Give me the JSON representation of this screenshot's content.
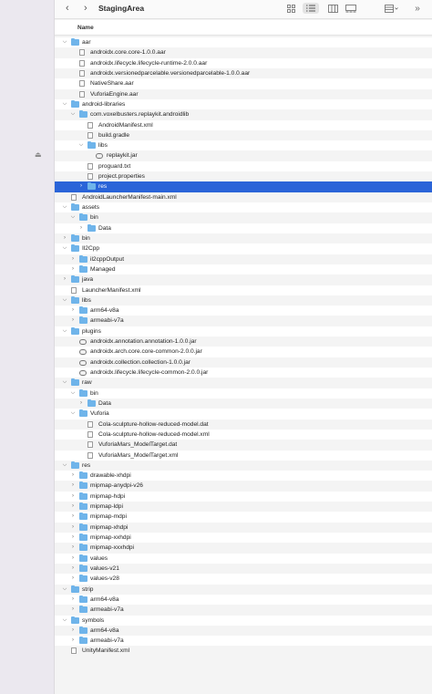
{
  "window": {
    "title": "StagingArea"
  },
  "toolbar": {
    "back_glyph": "‹",
    "forward_glyph": "›",
    "view_buttons": [
      "icon-view",
      "list-view",
      "column-view",
      "gallery-view",
      "group-view",
      "more"
    ]
  },
  "header": {
    "column_name": "Name"
  },
  "colors": {
    "selection": "#2a64d8",
    "folder": "#6fb4ea"
  },
  "tree": [
    {
      "label": "aar",
      "depth": 0,
      "type": "folder",
      "expanded": true
    },
    {
      "label": "androidx.core.core-1.0.0.aar",
      "depth": 1,
      "type": "doc"
    },
    {
      "label": "androidx.lifecycle.lifecycle-runtime-2.0.0.aar",
      "depth": 1,
      "type": "doc"
    },
    {
      "label": "androidx.versionedparcelable.versionedparcelable-1.0.0.aar",
      "depth": 1,
      "type": "doc"
    },
    {
      "label": "NativeShare.aar",
      "depth": 1,
      "type": "doc"
    },
    {
      "label": "VuforiaEngine.aar",
      "depth": 1,
      "type": "doc"
    },
    {
      "label": "android-libraries",
      "depth": 0,
      "type": "folder",
      "expanded": true
    },
    {
      "label": "com.voxelbusters.replaykit.androidlib",
      "depth": 1,
      "type": "folder",
      "expanded": true
    },
    {
      "label": "AndroidManifest.xml",
      "depth": 2,
      "type": "doc"
    },
    {
      "label": "build.gradle",
      "depth": 2,
      "type": "doc"
    },
    {
      "label": "libs",
      "depth": 2,
      "type": "folder",
      "expanded": true
    },
    {
      "label": "replaykit.jar",
      "depth": 3,
      "type": "jar"
    },
    {
      "label": "proguard.txt",
      "depth": 2,
      "type": "doc"
    },
    {
      "label": "project.properties",
      "depth": 2,
      "type": "doc"
    },
    {
      "label": "res",
      "depth": 2,
      "type": "folder",
      "expanded": false,
      "selected": true
    },
    {
      "label": "AndroidLauncherManifest-main.xml",
      "depth": 0,
      "type": "doc"
    },
    {
      "label": "assets",
      "depth": 0,
      "type": "folder",
      "expanded": true
    },
    {
      "label": "bin",
      "depth": 1,
      "type": "folder",
      "expanded": true
    },
    {
      "label": "Data",
      "depth": 2,
      "type": "folder",
      "expanded": false
    },
    {
      "label": "bin",
      "depth": 0,
      "type": "folder",
      "expanded": false
    },
    {
      "label": "Il2Cpp",
      "depth": 0,
      "type": "folder",
      "expanded": true
    },
    {
      "label": "il2cppOutput",
      "depth": 1,
      "type": "folder",
      "expanded": false
    },
    {
      "label": "Managed",
      "depth": 1,
      "type": "folder",
      "expanded": false
    },
    {
      "label": "java",
      "depth": 0,
      "type": "folder",
      "expanded": false
    },
    {
      "label": "LauncherManifest.xml",
      "depth": 0,
      "type": "doc"
    },
    {
      "label": "libs",
      "depth": 0,
      "type": "folder",
      "expanded": true
    },
    {
      "label": "arm64-v8a",
      "depth": 1,
      "type": "folder",
      "expanded": false
    },
    {
      "label": "armeabi-v7a",
      "depth": 1,
      "type": "folder",
      "expanded": false
    },
    {
      "label": "plugins",
      "depth": 0,
      "type": "folder",
      "expanded": true
    },
    {
      "label": "androidx.annotation.annotation-1.0.0.jar",
      "depth": 1,
      "type": "jar"
    },
    {
      "label": "androidx.arch.core.core-common-2.0.0.jar",
      "depth": 1,
      "type": "jar"
    },
    {
      "label": "androidx.collection.collection-1.0.0.jar",
      "depth": 1,
      "type": "jar"
    },
    {
      "label": "androidx.lifecycle.lifecycle-common-2.0.0.jar",
      "depth": 1,
      "type": "jar"
    },
    {
      "label": "raw",
      "depth": 0,
      "type": "folder",
      "expanded": true
    },
    {
      "label": "bin",
      "depth": 1,
      "type": "folder",
      "expanded": true
    },
    {
      "label": "Data",
      "depth": 2,
      "type": "folder",
      "expanded": false
    },
    {
      "label": "Vuforia",
      "depth": 1,
      "type": "folder",
      "expanded": true
    },
    {
      "label": "Cola-sculpture-hollow-reduced-model.dat",
      "depth": 2,
      "type": "doc"
    },
    {
      "label": "Cola-sculpture-hollow-reduced-model.xml",
      "depth": 2,
      "type": "doc"
    },
    {
      "label": "VuforiaMars_ModelTarget.dat",
      "depth": 2,
      "type": "doc"
    },
    {
      "label": "VuforiaMars_ModelTarget.xml",
      "depth": 2,
      "type": "doc"
    },
    {
      "label": "res",
      "depth": 0,
      "type": "folder",
      "expanded": true
    },
    {
      "label": "drawable-xhdpi",
      "depth": 1,
      "type": "folder",
      "expanded": false
    },
    {
      "label": "mipmap-anydpi-v26",
      "depth": 1,
      "type": "folder",
      "expanded": false
    },
    {
      "label": "mipmap-hdpi",
      "depth": 1,
      "type": "folder",
      "expanded": false
    },
    {
      "label": "mipmap-ldpi",
      "depth": 1,
      "type": "folder",
      "expanded": false
    },
    {
      "label": "mipmap-mdpi",
      "depth": 1,
      "type": "folder",
      "expanded": false
    },
    {
      "label": "mipmap-xhdpi",
      "depth": 1,
      "type": "folder",
      "expanded": false
    },
    {
      "label": "mipmap-xxhdpi",
      "depth": 1,
      "type": "folder",
      "expanded": false
    },
    {
      "label": "mipmap-xxxhdpi",
      "depth": 1,
      "type": "folder",
      "expanded": false
    },
    {
      "label": "values",
      "depth": 1,
      "type": "folder",
      "expanded": false
    },
    {
      "label": "values-v21",
      "depth": 1,
      "type": "folder",
      "expanded": false
    },
    {
      "label": "values-v28",
      "depth": 1,
      "type": "folder",
      "expanded": false
    },
    {
      "label": "strip",
      "depth": 0,
      "type": "folder",
      "expanded": true
    },
    {
      "label": "arm64-v8a",
      "depth": 1,
      "type": "folder",
      "expanded": false
    },
    {
      "label": "armeabi-v7a",
      "depth": 1,
      "type": "folder",
      "expanded": false
    },
    {
      "label": "symbols",
      "depth": 0,
      "type": "folder",
      "expanded": true
    },
    {
      "label": "arm64-v8a",
      "depth": 1,
      "type": "folder",
      "expanded": false
    },
    {
      "label": "armeabi-v7a",
      "depth": 1,
      "type": "folder",
      "expanded": false
    },
    {
      "label": "UnityManifest.xml",
      "depth": 0,
      "type": "doc"
    }
  ]
}
